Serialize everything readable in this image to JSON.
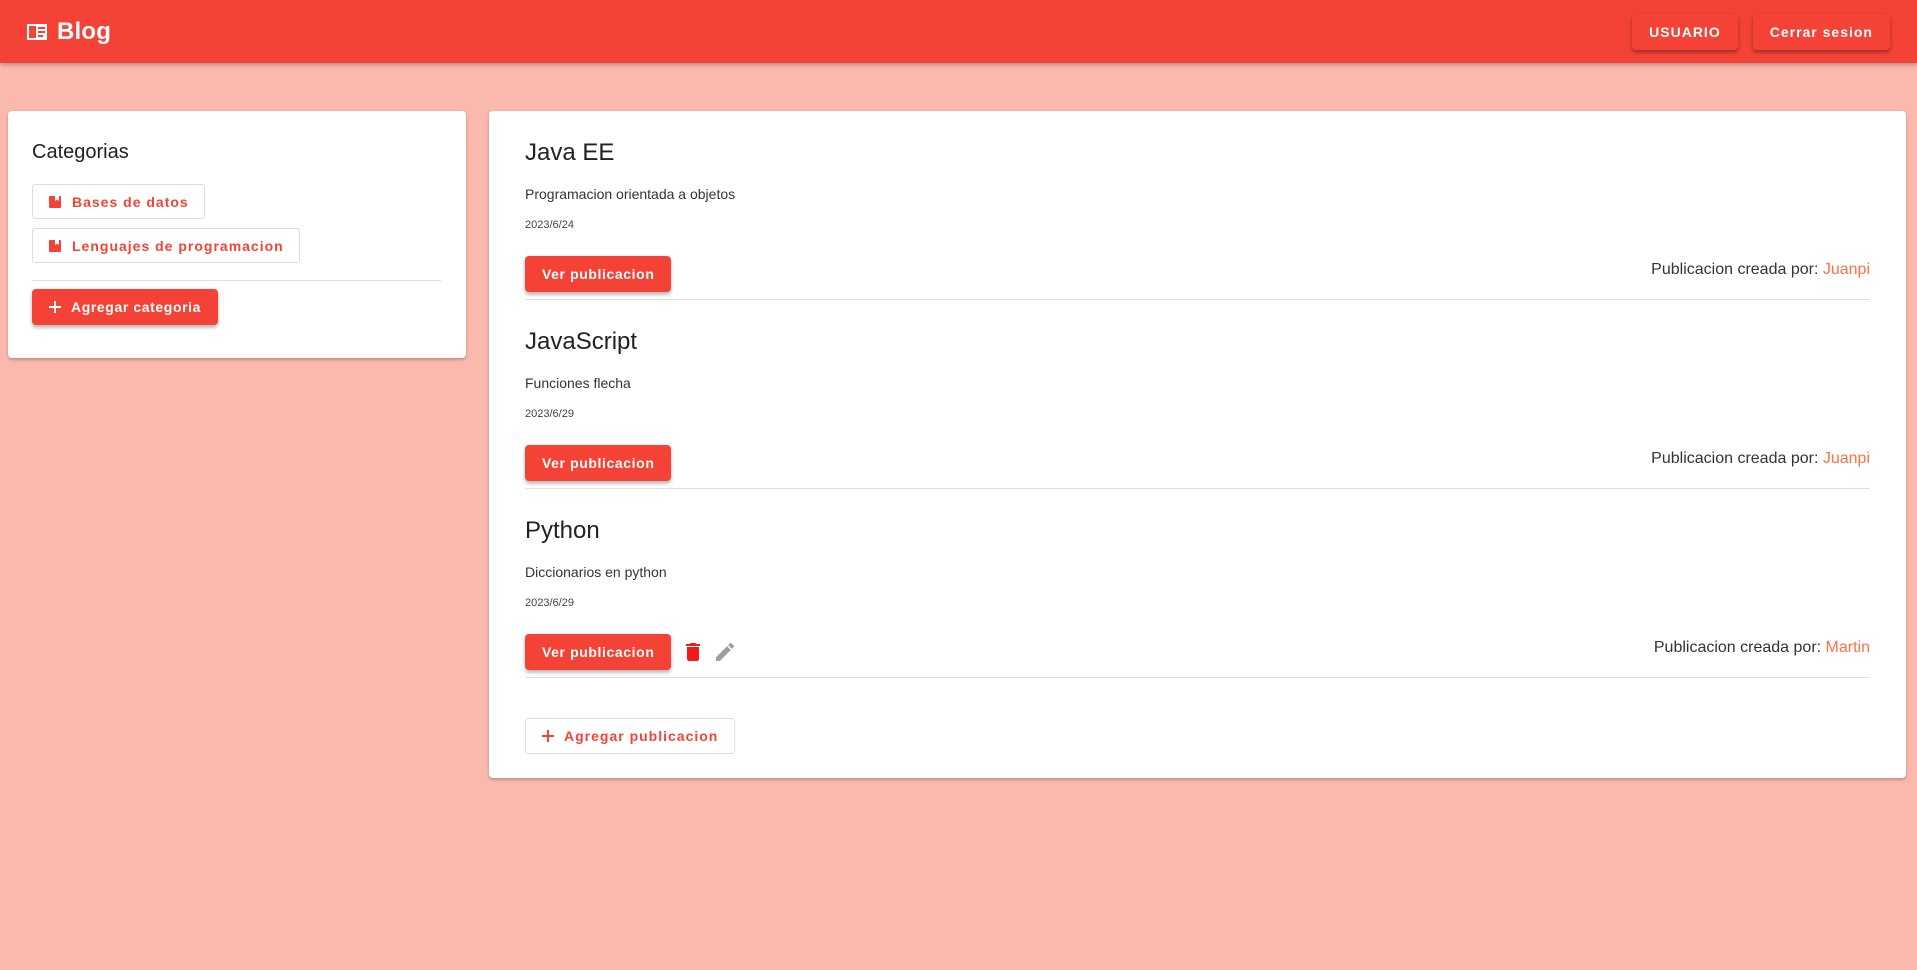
{
  "app": {
    "title": "Blog",
    "user_button": "Usuario",
    "logout_button": "Cerrar sesion",
    "accent_color": "#f44336",
    "background_color": "#fbb9ae",
    "author_color": "#ff7043"
  },
  "sidebar": {
    "title": "Categorias",
    "categories": [
      {
        "label": "Bases de datos",
        "icon": "book-icon"
      },
      {
        "label": "Lenguajes de programacion",
        "icon": "book-icon"
      }
    ],
    "add_button": "Agregar categoria"
  },
  "posts": [
    {
      "title": "Java EE",
      "description": "Programacion orientada a objetos",
      "date": "2023/6/24",
      "view_label": "Ver publicacion",
      "author_prefix": "Publicacion creada por:",
      "author": "Juanpi",
      "can_edit": false
    },
    {
      "title": "JavaScript",
      "description": "Funciones flecha",
      "date": "2023/6/29",
      "view_label": "Ver publicacion",
      "author_prefix": "Publicacion creada por:",
      "author": "Juanpi",
      "can_edit": false
    },
    {
      "title": "Python",
      "description": "Diccionarios en python",
      "date": "2023/6/29",
      "view_label": "Ver publicacion",
      "author_prefix": "Publicacion creada por:",
      "author": "Martin",
      "can_edit": true
    }
  ],
  "add_post_button": "Agregar publicacion"
}
